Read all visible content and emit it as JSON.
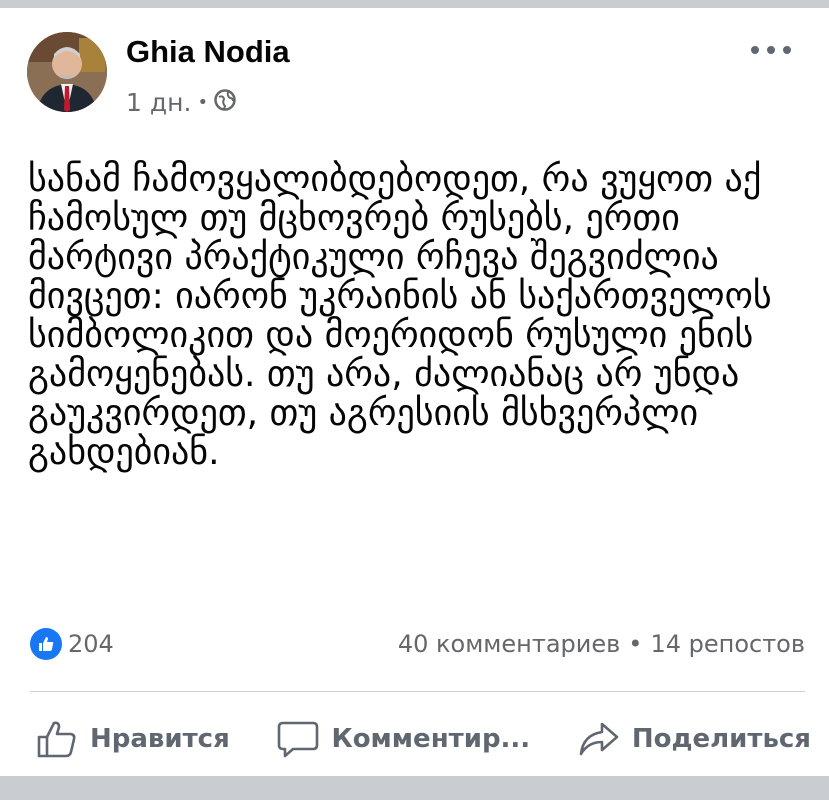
{
  "post": {
    "author": "Ghia Nodia",
    "time": "1 дн.",
    "privacy_icon": "globe-icon",
    "text": "სანამ ჩამოვყალიბდებოდეთ, რა ვუყოთ აქ ჩამოსულ თუ მცხოვრებ რუსებს, ერთი მარტივი პრაქტიკული რჩევა შეგვიძლია მივცეთ: იარონ უკრაინის ან საქართველოს სიმბოლიკით და მოერიდონ რუსული ენის გამოყენებას. თუ არა, ძალიანაც არ უნდა გაუკვირდეთ, თუ აგრესიის მსხვერპლი გახდებიან."
  },
  "stats": {
    "likes": "204",
    "comments": "40 комментариев",
    "separator": "•",
    "shares": "14 репостов"
  },
  "actions": {
    "like": "Нравится",
    "comment": "Комментир...",
    "share": "Поделиться"
  },
  "colors": {
    "brand": "#1877f2",
    "secondary_text": "#65676b",
    "action_text": "#606770",
    "background": "#c9ccd1"
  }
}
